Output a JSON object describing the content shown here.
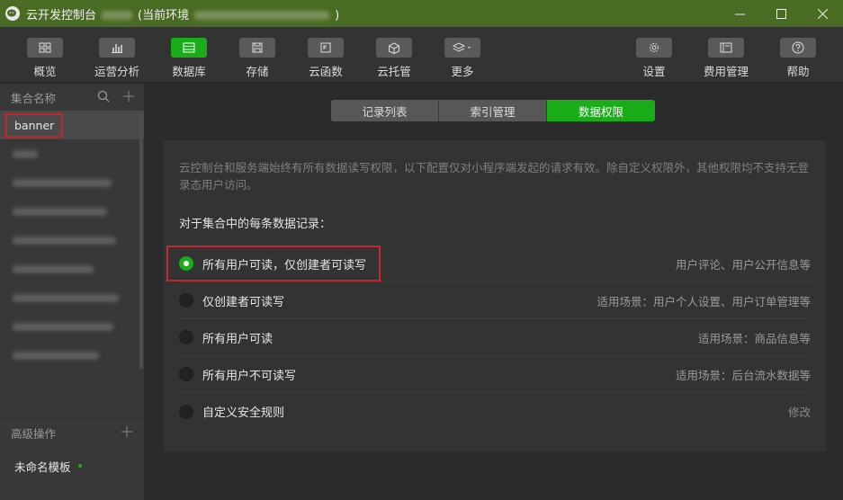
{
  "window": {
    "title_prefix": "云开发控制台",
    "title_env": "(当前环境",
    "title_suffix": ")"
  },
  "toolbar": {
    "items": [
      {
        "label": "概览",
        "icon": "grid-icon"
      },
      {
        "label": "运营分析",
        "icon": "bar-chart-icon"
      },
      {
        "label": "数据库",
        "icon": "database-icon",
        "active": true
      },
      {
        "label": "存储",
        "icon": "storage-icon"
      },
      {
        "label": "云函数",
        "icon": "function-icon"
      },
      {
        "label": "云托管",
        "icon": "cube-icon"
      },
      {
        "label": "更多",
        "icon": "layers-icon"
      },
      {
        "label": "设置",
        "icon": "gear-icon"
      },
      {
        "label": "费用管理",
        "icon": "billing-icon"
      },
      {
        "label": "帮助",
        "icon": "help-icon"
      }
    ]
  },
  "sidebar": {
    "header": "集合名称",
    "selected_collection": "banner",
    "advanced_header": "高级操作",
    "template_label": "未命名模板"
  },
  "tabs": [
    {
      "label": "记录列表"
    },
    {
      "label": "索引管理"
    },
    {
      "label": "数据权限",
      "active": true
    }
  ],
  "permissions": {
    "description": "云控制台和服务端始终有所有数据读写权限，以下配置仅对小程序端发起的请求有效。除自定义权限外，其他权限均不支持无登录态用户访问。",
    "section_title": "对于集合中的每条数据记录：",
    "options": [
      {
        "label": "所有用户可读，仅创建者可读写",
        "hint": "用户评论、用户公开信息等",
        "selected": true
      },
      {
        "label": "仅创建者可读写",
        "hint": "适用场景：用户个人设置、用户订单管理等",
        "selected": false
      },
      {
        "label": "所有用户可读",
        "hint": "适用场景：商品信息等",
        "selected": false
      },
      {
        "label": "所有用户不可读写",
        "hint": "适用场景：后台流水数据等",
        "selected": false
      },
      {
        "label": "自定义安全规则",
        "hint": "修改",
        "selected": false
      }
    ]
  },
  "colors": {
    "accent": "#1aad19",
    "titlebar": "#4a6b23",
    "highlight": "#c2272d"
  }
}
